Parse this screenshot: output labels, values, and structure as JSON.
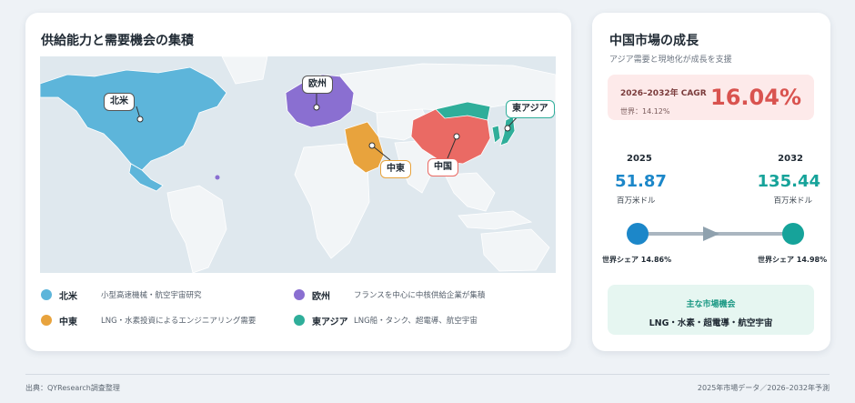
{
  "left_card": {
    "title": "供給能力と需要機会の集積",
    "map_labels": {
      "north_america": "北米",
      "europe": "欧州",
      "middle_east": "中東",
      "china": "中国",
      "east_asia": "東アジア"
    },
    "legend": [
      {
        "name": "北米",
        "desc": "小型高速機械・航空宇宙研究",
        "color": "#5db5da"
      },
      {
        "name": "欧州",
        "desc": "フランスを中心に中核供給企業が集積",
        "color": "#8a6fd1"
      },
      {
        "name": "中東",
        "desc": "LNG・水素投資によるエンジニアリング需要",
        "color": "#e8a33d"
      },
      {
        "name": "東アジア",
        "desc": "LNG船・タンク、超電導、航空宇宙",
        "color": "#2fae9a"
      }
    ],
    "colors": {
      "north_america": "#5db5da",
      "europe": "#8a6fd1",
      "middle_east": "#e8a33d",
      "china": "#ea6a64",
      "east_asia": "#2fae9a",
      "land": "#f2f5f7",
      "sea": "#dfe8ee"
    }
  },
  "right_card": {
    "title": "中国市場の成長",
    "subtitle": "アジア需要と現地化が成長を支援",
    "cagr": {
      "label": "2026–2032年 CAGR",
      "value": "16.04%",
      "world": "世界：14.12%"
    },
    "start": {
      "year": "2025",
      "value": "51.87",
      "unit": "百万米ドル",
      "share": "世界シェア 14.86%"
    },
    "end": {
      "year": "2032",
      "value": "135.44",
      "unit": "百万米ドル",
      "share": "世界シェア 14.98%"
    },
    "opportunity": {
      "title": "主な市場機会",
      "items": "LNG・水素・超電導・航空宇宙"
    }
  },
  "footer": {
    "source": "出典：QYResearch調査整理",
    "note": "2025年市場データ／2026–2032年予測"
  }
}
